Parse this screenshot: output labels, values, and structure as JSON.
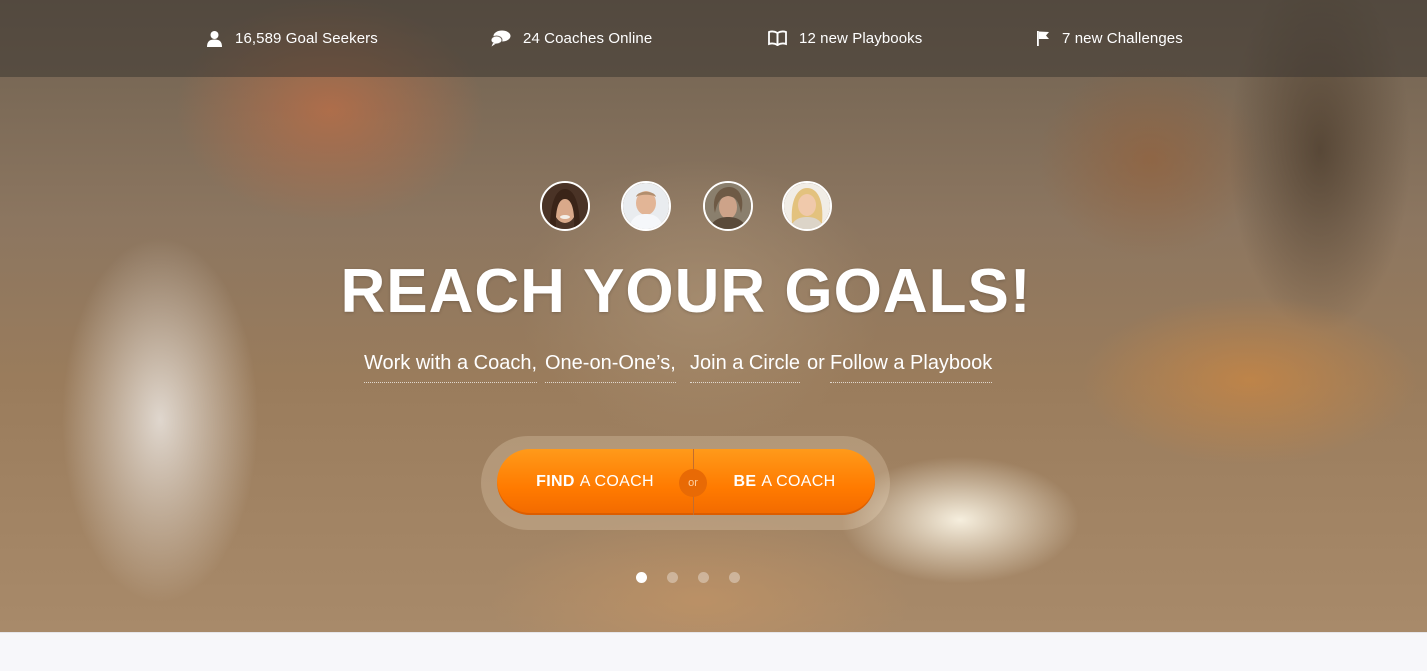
{
  "stats": {
    "seekers": "16,589 Goal Seekers",
    "coaches": "24 Coaches Online",
    "playbooks": "12 new Playbooks",
    "challenges": "7 new Challenges"
  },
  "hero": {
    "headline": "REACH YOUR GOALS!",
    "subline": {
      "coach": "Work with a Coach,",
      "one_on_one": "One-on-One’s,",
      "circle": "Join a Circle",
      "or": "or",
      "playbook": "Follow a Playbook"
    }
  },
  "cta": {
    "find_bold": "FIND",
    "find_rest": "A COACH",
    "or": "or",
    "be_bold": "BE",
    "be_rest": "A COACH"
  },
  "carousel": {
    "slide_count": 4,
    "active_index": 0
  },
  "colors": {
    "accent": "#ff8a0d",
    "text": "#ffffff"
  },
  "icons": {
    "seekers": "user-icon",
    "coaches": "chat-bubbles-icon",
    "playbooks": "book-icon",
    "challenges": "flag-icon"
  }
}
